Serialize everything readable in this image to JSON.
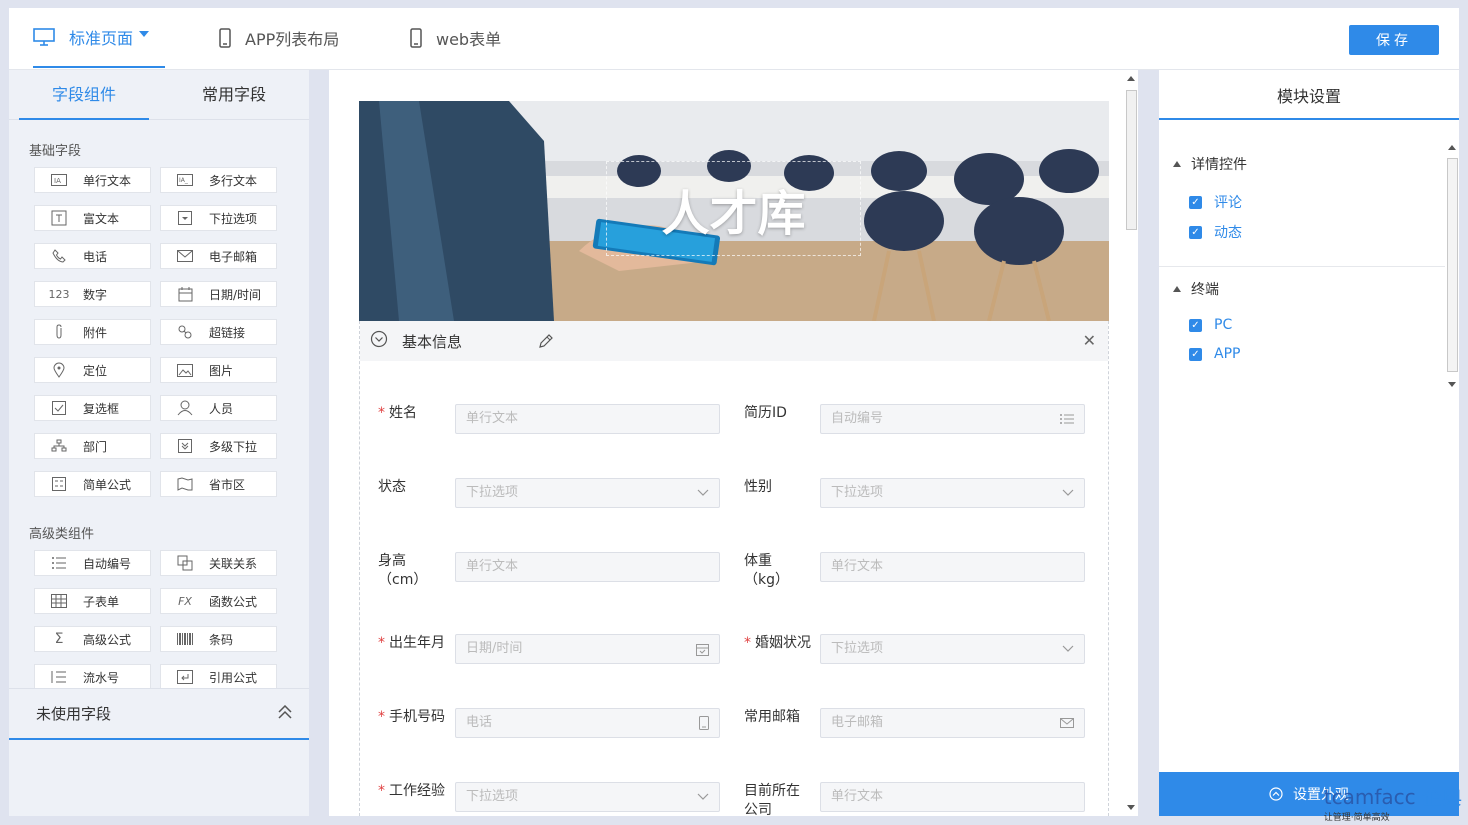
{
  "topbar": {
    "tabs": [
      {
        "label": "标准页面",
        "icon": "monitor-icon"
      },
      {
        "label": "APP列表布局",
        "icon": "phone-icon"
      },
      {
        "label": "web表单",
        "icon": "phone-icon"
      }
    ],
    "save_label": "保存"
  },
  "left": {
    "tabs": [
      "字段组件",
      "常用字段"
    ],
    "basic_title": "基础字段",
    "basic_fields": [
      {
        "label": "单行文本",
        "icon": "single-line-text-icon"
      },
      {
        "label": "多行文本",
        "icon": "multi-line-text-icon"
      },
      {
        "label": "富文本",
        "icon": "rich-text-icon"
      },
      {
        "label": "下拉选项",
        "icon": "dropdown-icon"
      },
      {
        "label": "电话",
        "icon": "phone-icon"
      },
      {
        "label": "电子邮箱",
        "icon": "mail-icon"
      },
      {
        "label": "数字",
        "icon": "number-icon"
      },
      {
        "label": "日期/时间",
        "icon": "calendar-icon"
      },
      {
        "label": "附件",
        "icon": "paperclip-icon"
      },
      {
        "label": "超链接",
        "icon": "link-icon"
      },
      {
        "label": "定位",
        "icon": "location-icon"
      },
      {
        "label": "图片",
        "icon": "image-icon"
      },
      {
        "label": "复选框",
        "icon": "checkbox-icon"
      },
      {
        "label": "人员",
        "icon": "person-icon"
      },
      {
        "label": "部门",
        "icon": "org-icon"
      },
      {
        "label": "多级下拉",
        "icon": "cascade-icon"
      },
      {
        "label": "简单公式",
        "icon": "calculator-icon"
      },
      {
        "label": "省市区",
        "icon": "map-icon"
      }
    ],
    "advanced_title": "高级类组件",
    "advanced_fields": [
      {
        "label": "自动编号",
        "icon": "numbered-list-icon"
      },
      {
        "label": "关联关系",
        "icon": "relation-icon"
      },
      {
        "label": "子表单",
        "icon": "table-icon"
      },
      {
        "label": "函数公式",
        "icon": "function-icon"
      },
      {
        "label": "高级公式",
        "icon": "sigma-icon"
      },
      {
        "label": "条码",
        "icon": "barcode-icon"
      },
      {
        "label": "流水号",
        "icon": "serial-icon"
      },
      {
        "label": "引用公式",
        "icon": "reference-icon"
      }
    ],
    "unused_label": "未使用字段"
  },
  "center": {
    "banner_title": "人才库",
    "section_title": "基本信息",
    "rows": [
      [
        {
          "label": "姓名",
          "required": true,
          "placeholder": "单行文本",
          "suffix": ""
        },
        {
          "label": "简历ID",
          "required": false,
          "placeholder": "自动编号",
          "suffix": "list"
        }
      ],
      [
        {
          "label": "状态",
          "required": false,
          "placeholder": "下拉选项",
          "suffix": "chevron"
        },
        {
          "label": "性别",
          "required": false,
          "placeholder": "下拉选项",
          "suffix": "chevron"
        }
      ],
      [
        {
          "label": "身高",
          "label2": "（cm）",
          "required": false,
          "placeholder": "单行文本",
          "suffix": ""
        },
        {
          "label": "体重",
          "label2": "（kg）",
          "required": false,
          "placeholder": "单行文本",
          "suffix": ""
        }
      ],
      [
        {
          "label": "出生年月",
          "required": true,
          "placeholder": "日期/时间",
          "suffix": "calendar"
        },
        {
          "label": "婚姻状况",
          "required": true,
          "placeholder": "下拉选项",
          "suffix": "chevron"
        }
      ],
      [
        {
          "label": "手机号码",
          "required": true,
          "placeholder": "电话",
          "suffix": "phone"
        },
        {
          "label": "常用邮箱",
          "required": false,
          "placeholder": "电子邮箱",
          "suffix": "mail"
        }
      ],
      [
        {
          "label": "工作经验",
          "required": true,
          "placeholder": "下拉选项",
          "suffix": "chevron"
        },
        {
          "label": "目前所在",
          "label2": "公司",
          "required": false,
          "placeholder": "单行文本",
          "suffix": ""
        }
      ]
    ]
  },
  "right": {
    "title": "模块设置",
    "groups": [
      {
        "title": "详情控件",
        "items": [
          "评论",
          "动态"
        ]
      },
      {
        "title": "终端",
        "items": [
          "PC",
          "APP"
        ]
      }
    ],
    "appearance_label": "设置外观",
    "watermark": "tcamfacc",
    "watermark_sub": "让管理·简单高效",
    "watermark_cn": "企典"
  }
}
